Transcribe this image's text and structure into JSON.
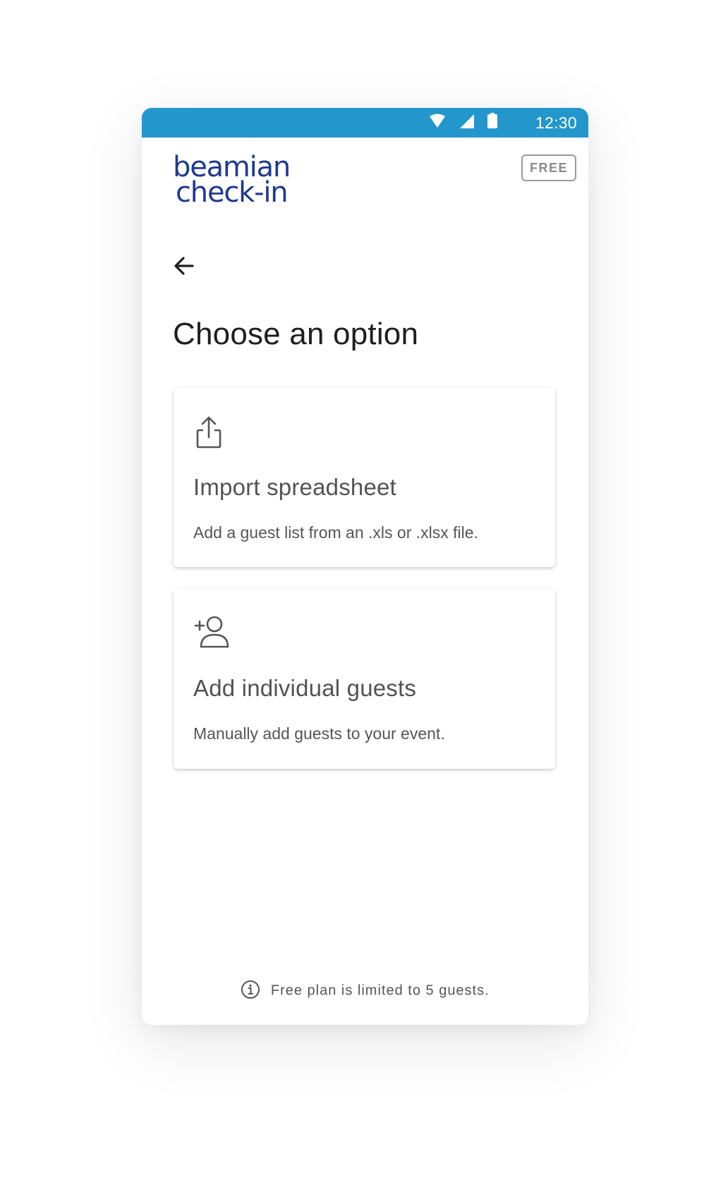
{
  "status_bar": {
    "time": "12:30",
    "background_color": "#2396cb",
    "icons": [
      "wifi-icon",
      "signal-icon",
      "battery-icon"
    ]
  },
  "header": {
    "logo_line1": "beamian",
    "logo_line2": "check-in",
    "logo_color": "#1f3a8e",
    "plan_badge": "FREE"
  },
  "nav": {
    "back_icon": "arrow-left-icon"
  },
  "page": {
    "title": "Choose an option"
  },
  "options": [
    {
      "icon": "share-upload-icon",
      "title": "Import spreadsheet",
      "description": "Add a guest list from an .xls or .xlsx file."
    },
    {
      "icon": "add-person-icon",
      "title": "Add individual guests",
      "description": "Manually add guests to your event."
    }
  ],
  "footer": {
    "icon": "info-icon",
    "note": "Free plan is limited to 5 guests."
  }
}
